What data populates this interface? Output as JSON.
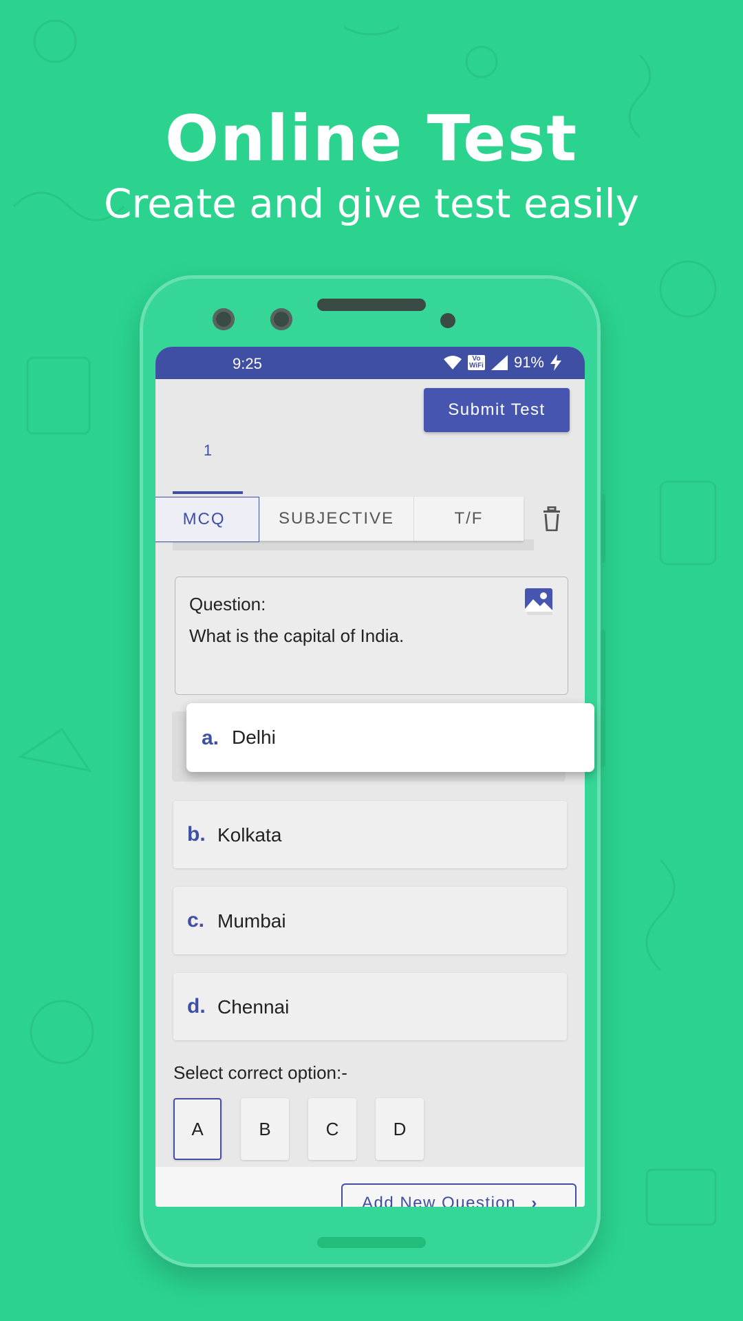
{
  "hero": {
    "title": "Online Test",
    "subtitle": "Create and give test easily"
  },
  "status_bar": {
    "time": "9:25",
    "battery": "91%",
    "vowifi_top": "Vo",
    "vowifi_bottom": "WiFi"
  },
  "toolbar": {
    "submit_label": "Submit Test"
  },
  "question_tabs": [
    "1"
  ],
  "type_tabs": [
    {
      "label": "MCQ",
      "active": true
    },
    {
      "label": "SUBJECTIVE",
      "active": false
    },
    {
      "label": "T/F",
      "active": false
    }
  ],
  "question": {
    "label": "Question:",
    "text": "What is the capital of India."
  },
  "options": [
    {
      "letter": "a.",
      "text": "Delhi"
    },
    {
      "letter": "b.",
      "text": "Kolkata"
    },
    {
      "letter": "c.",
      "text": "Mumbai"
    },
    {
      "letter": "d.",
      "text": "Chennai"
    }
  ],
  "correct_option": {
    "label": "Select correct option:-",
    "choices": [
      "A",
      "B",
      "C",
      "D"
    ],
    "selected": "A"
  },
  "footer": {
    "add_question_label": "Add New Question",
    "add_question_arrow": "›"
  },
  "colors": {
    "background": "#2bd38f",
    "accent": "#3f4fa3",
    "phone_body": "#35d698"
  }
}
